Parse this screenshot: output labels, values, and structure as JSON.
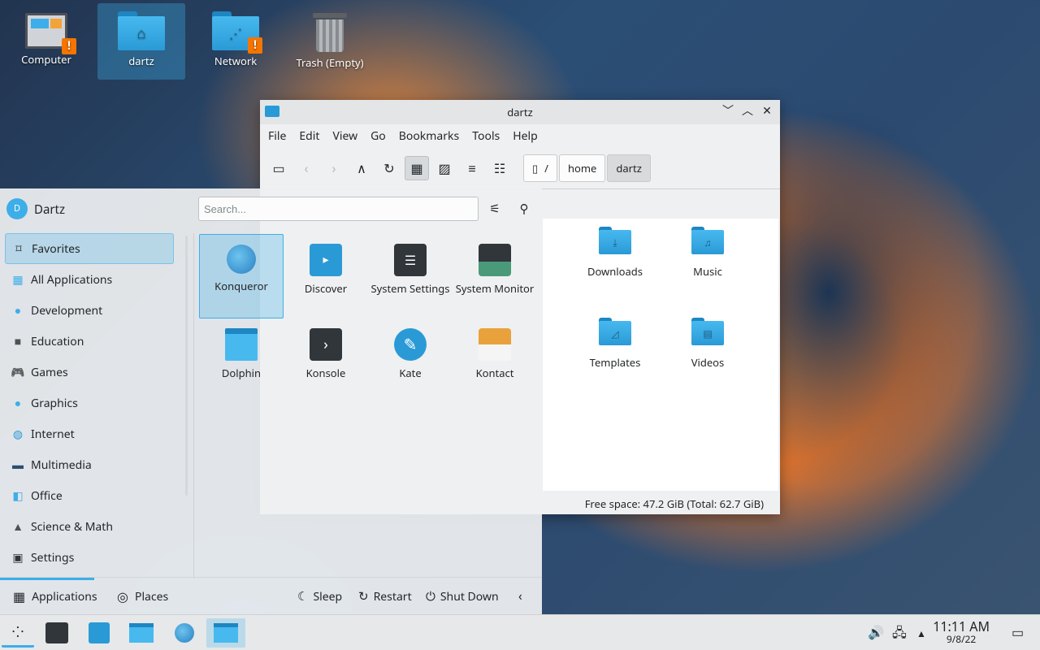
{
  "desktop": {
    "icons": [
      {
        "label": "Computer",
        "icon": "computer-icon"
      },
      {
        "label": "dartz",
        "icon": "home-folder-icon"
      },
      {
        "label": "Network",
        "icon": "network-folder-icon"
      },
      {
        "label": "Trash (Empty)",
        "icon": "trash-icon"
      }
    ]
  },
  "window": {
    "title": "dartz",
    "menus": [
      "File",
      "Edit",
      "View",
      "Go",
      "Bookmarks",
      "Tools",
      "Help"
    ],
    "breadcrumbs": [
      "/",
      "home",
      "dartz"
    ],
    "files": [
      {
        "name": "Downloads",
        "glyph": "⤓"
      },
      {
        "name": "Music",
        "glyph": "♫"
      },
      {
        "name": "Templates",
        "glyph": "◿"
      },
      {
        "name": "Videos",
        "glyph": "▤"
      }
    ],
    "status_free_space": "Free space: 47.2 GiB (Total: 62.7 GiB)"
  },
  "launcher": {
    "avatar_initial": "D",
    "username": "Dartz",
    "search_placeholder": "Search...",
    "categories": [
      {
        "label": "Favorites",
        "icon": "bookmark-icon"
      },
      {
        "label": "All Applications",
        "icon": "grid-icon"
      },
      {
        "label": "Development",
        "icon": "development-icon"
      },
      {
        "label": "Education",
        "icon": "education-icon"
      },
      {
        "label": "Games",
        "icon": "gamepad-icon"
      },
      {
        "label": "Graphics",
        "icon": "graphics-icon"
      },
      {
        "label": "Internet",
        "icon": "globe-icon"
      },
      {
        "label": "Multimedia",
        "icon": "multimedia-icon"
      },
      {
        "label": "Office",
        "icon": "office-icon"
      },
      {
        "label": "Science & Math",
        "icon": "science-icon"
      },
      {
        "label": "Settings",
        "icon": "settings-icon"
      }
    ],
    "apps": [
      {
        "label": "Konqueror",
        "icon": "konqueror-icon"
      },
      {
        "label": "Discover",
        "icon": "discover-icon"
      },
      {
        "label": "System Settings",
        "icon": "system-settings-icon"
      },
      {
        "label": "System Monitor",
        "icon": "system-monitor-icon"
      },
      {
        "label": "Dolphin",
        "icon": "dolphin-icon"
      },
      {
        "label": "Konsole",
        "icon": "konsole-icon"
      },
      {
        "label": "Kate",
        "icon": "kate-icon"
      },
      {
        "label": "Kontact",
        "icon": "kontact-icon"
      }
    ],
    "footer": {
      "applications": "Applications",
      "places": "Places",
      "sleep": "Sleep",
      "restart": "Restart",
      "shutdown": "Shut Down"
    }
  },
  "taskbar": {
    "time": "11:11 AM",
    "date": "9/8/22"
  },
  "colors": {
    "accent": "#3daee9",
    "folder": "#2a9ad6",
    "warning": "#f67400"
  }
}
